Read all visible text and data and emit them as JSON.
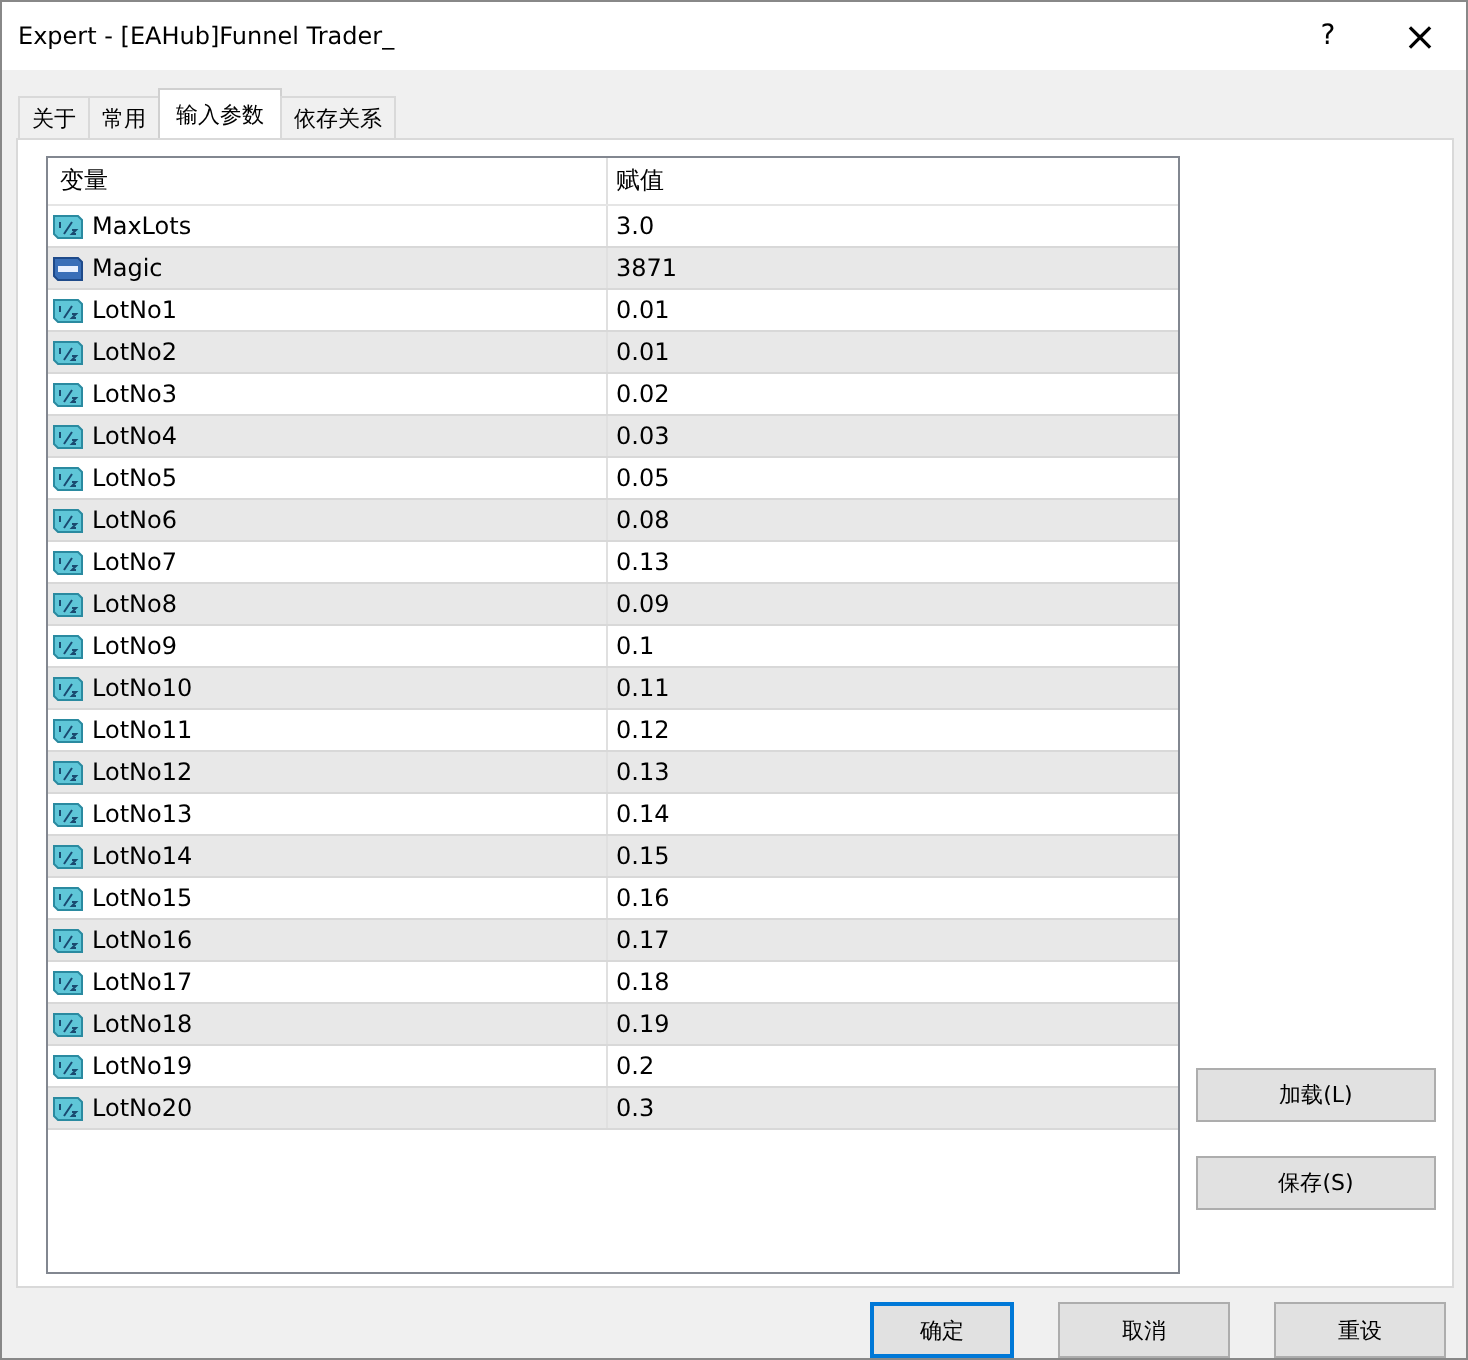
{
  "window": {
    "title": "Expert - [EAHub]Funnel Trader_",
    "help": "?",
    "close": "×"
  },
  "tabs": [
    {
      "label": "关于",
      "selected": false
    },
    {
      "label": "常用",
      "selected": false
    },
    {
      "label": "输入参数",
      "selected": true
    },
    {
      "label": "依存关系",
      "selected": false
    }
  ],
  "table": {
    "columns": [
      "变量",
      "赋值"
    ],
    "rows": [
      {
        "kind": "double",
        "name": "MaxLots",
        "value": "3.0"
      },
      {
        "kind": "int",
        "name": "Magic",
        "value": "3871"
      },
      {
        "kind": "double",
        "name": "LotNo1",
        "value": "0.01"
      },
      {
        "kind": "double",
        "name": "LotNo2",
        "value": "0.01"
      },
      {
        "kind": "double",
        "name": "LotNo3",
        "value": "0.02"
      },
      {
        "kind": "double",
        "name": "LotNo4",
        "value": "0.03"
      },
      {
        "kind": "double",
        "name": "LotNo5",
        "value": "0.05"
      },
      {
        "kind": "double",
        "name": "LotNo6",
        "value": "0.08"
      },
      {
        "kind": "double",
        "name": "LotNo7",
        "value": "0.13"
      },
      {
        "kind": "double",
        "name": "LotNo8",
        "value": "0.09"
      },
      {
        "kind": "double",
        "name": "LotNo9",
        "value": "0.1"
      },
      {
        "kind": "double",
        "name": "LotNo10",
        "value": "0.11"
      },
      {
        "kind": "double",
        "name": "LotNo11",
        "value": "0.12"
      },
      {
        "kind": "double",
        "name": "LotNo12",
        "value": "0.13"
      },
      {
        "kind": "double",
        "name": "LotNo13",
        "value": "0.14"
      },
      {
        "kind": "double",
        "name": "LotNo14",
        "value": "0.15"
      },
      {
        "kind": "double",
        "name": "LotNo15",
        "value": "0.16"
      },
      {
        "kind": "double",
        "name": "LotNo16",
        "value": "0.17"
      },
      {
        "kind": "double",
        "name": "LotNo17",
        "value": "0.18"
      },
      {
        "kind": "double",
        "name": "LotNo18",
        "value": "0.19"
      },
      {
        "kind": "double",
        "name": "LotNo19",
        "value": "0.2"
      },
      {
        "kind": "double",
        "name": "LotNo20",
        "value": "0.3"
      }
    ]
  },
  "side_buttons": [
    "加载(L)",
    "保存(S)"
  ],
  "buttons": [
    {
      "label": "确定",
      "default": true
    },
    {
      "label": "取消",
      "default": false
    },
    {
      "label": "重设",
      "default": false
    }
  ]
}
